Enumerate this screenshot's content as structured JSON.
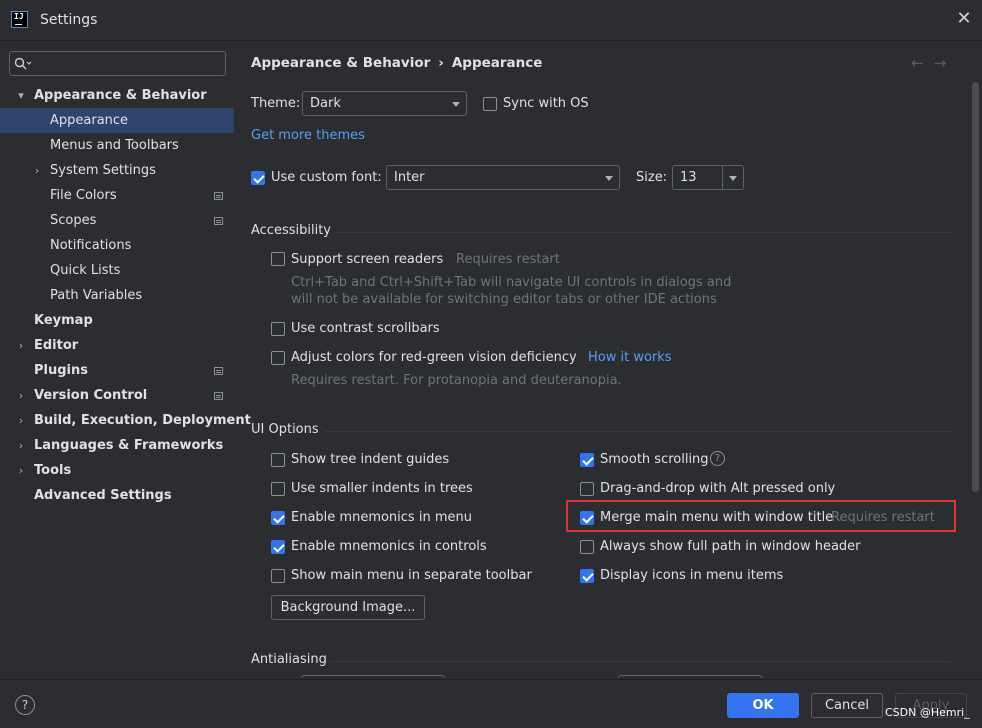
{
  "window": {
    "title": "Settings",
    "app_icon_text": "IJ"
  },
  "sidebar": {
    "search_placeholder": "",
    "items": [
      {
        "label": "Appearance & Behavior",
        "level": 0,
        "bold": true,
        "expanded": true,
        "chevron": "▾"
      },
      {
        "label": "Appearance",
        "level": 1,
        "selected": true
      },
      {
        "label": "Menus and Toolbars",
        "level": 1
      },
      {
        "label": "System Settings",
        "level": 1,
        "chevron": "›"
      },
      {
        "label": "File Colors",
        "level": 1,
        "badge": true
      },
      {
        "label": "Scopes",
        "level": 1,
        "badge": true
      },
      {
        "label": "Notifications",
        "level": 1
      },
      {
        "label": "Quick Lists",
        "level": 1
      },
      {
        "label": "Path Variables",
        "level": 1
      },
      {
        "label": "Keymap",
        "level": 0,
        "bold": true
      },
      {
        "label": "Editor",
        "level": 0,
        "bold": true,
        "chevron": "›"
      },
      {
        "label": "Plugins",
        "level": 0,
        "bold": true,
        "badge": true
      },
      {
        "label": "Version Control",
        "level": 0,
        "bold": true,
        "chevron": "›",
        "badge": true
      },
      {
        "label": "Build, Execution, Deployment",
        "level": 0,
        "bold": true,
        "chevron": "›"
      },
      {
        "label": "Languages & Frameworks",
        "level": 0,
        "bold": true,
        "chevron": "›"
      },
      {
        "label": "Tools",
        "level": 0,
        "bold": true,
        "chevron": "›"
      },
      {
        "label": "Advanced Settings",
        "level": 0,
        "bold": true
      }
    ]
  },
  "breadcrumb": {
    "parent": "Appearance & Behavior",
    "separator": "›",
    "current": "Appearance"
  },
  "nav": {
    "back": "←",
    "forward": "→"
  },
  "theme": {
    "label": "Theme:",
    "value": "Dark",
    "sync_label": "Sync with OS",
    "sync_checked": false,
    "get_more": "Get more themes"
  },
  "font": {
    "custom_label": "Use custom font:",
    "custom_checked": true,
    "value": "Inter",
    "size_label": "Size:",
    "size_value": "13"
  },
  "accessibility": {
    "title": "Accessibility",
    "screen_readers": "Support screen readers",
    "screen_readers_hint": "Requires restart",
    "screen_readers_desc1": "Ctrl+Tab and Ctrl+Shift+Tab will navigate UI controls in dialogs and",
    "screen_readers_desc2": "will not be available for switching editor tabs or other IDE actions",
    "contrast": "Use contrast scrollbars",
    "color_def": "Adjust colors for red-green vision deficiency",
    "how_it_works": "How it works",
    "color_def_desc": "Requires restart. For protanopia and deuteranopia."
  },
  "ui_options": {
    "title": "UI Options",
    "left": [
      {
        "label": "Show tree indent guides",
        "checked": false
      },
      {
        "label": "Use smaller indents in trees",
        "checked": false
      },
      {
        "label": "Enable mnemonics in menu",
        "checked": true
      },
      {
        "label": "Enable mnemonics in controls",
        "checked": true
      },
      {
        "label": "Show main menu in separate toolbar",
        "checked": false
      }
    ],
    "right": [
      {
        "label": "Smooth scrolling",
        "checked": true
      },
      {
        "label": "Drag-and-drop with Alt pressed only",
        "checked": false
      },
      {
        "label": "Merge main menu with window title",
        "checked": true,
        "hint": "Requires restart"
      },
      {
        "label": "Always show full path in window header",
        "checked": false
      },
      {
        "label": "Display icons in menu items",
        "checked": true
      }
    ],
    "help_glyph": "?",
    "background_button": "Background Image..."
  },
  "antialiasing": {
    "title": "Antialiasing"
  },
  "footer": {
    "help": "?",
    "ok": "OK",
    "cancel": "Cancel",
    "apply": "Apply",
    "watermark": "CSDN @Hemri_"
  },
  "colors": {
    "accent": "#3574f0",
    "link": "#589df6",
    "selection": "#2e436e",
    "highlight_box": "#e03237"
  }
}
